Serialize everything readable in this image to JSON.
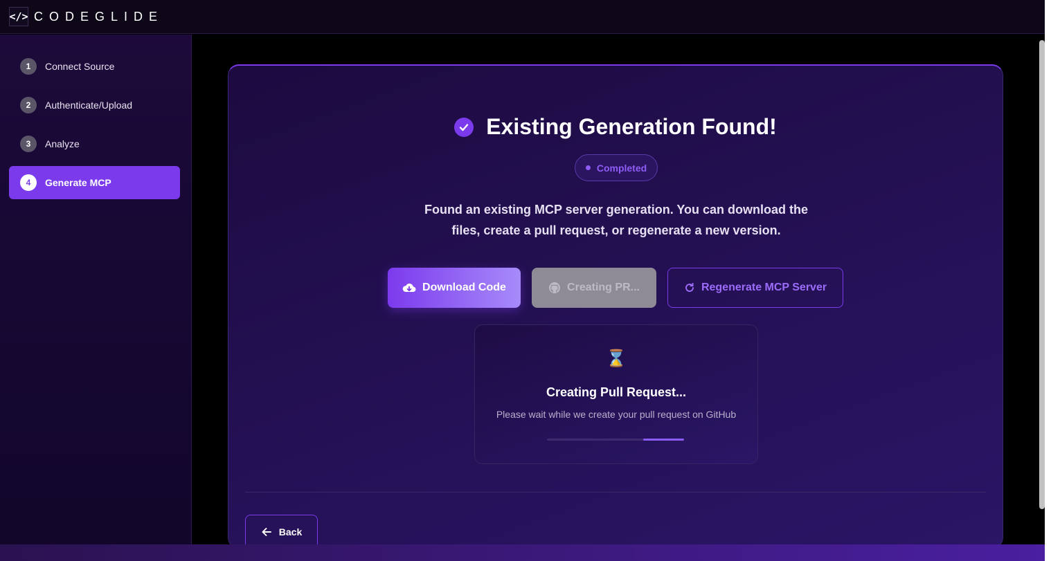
{
  "header": {
    "logo_mark": "</>",
    "logo_text": "CODEGLIDE"
  },
  "sidebar": {
    "steps": [
      {
        "number": "1",
        "label": "Connect Source"
      },
      {
        "number": "2",
        "label": "Authenticate/Upload"
      },
      {
        "number": "3",
        "label": "Analyze"
      },
      {
        "number": "4",
        "label": "Generate MCP",
        "active": true
      }
    ]
  },
  "main": {
    "title": "Existing Generation Found!",
    "status_badge": "Completed",
    "description": "Found an existing MCP server generation. You can download the files, create a pull request, or regenerate a new version.",
    "buttons": {
      "download": "Download Code",
      "pr": "Creating PR...",
      "regenerate": "Regenerate MCP Server",
      "back": "Back"
    },
    "pr_panel": {
      "icon": "⌛",
      "title": "Creating Pull Request...",
      "subtitle": "Please wait while we create your pull request on GitHub",
      "progress": {
        "start": 0.7,
        "end": 1.0
      }
    }
  },
  "colors": {
    "accent": "#7c3aed",
    "background": "#000000",
    "card": "#231052"
  },
  "icons": [
    "check-circle-icon",
    "cloud-download-icon",
    "github-icon",
    "refresh-icon",
    "hourglass-icon",
    "arrow-left-icon"
  ]
}
